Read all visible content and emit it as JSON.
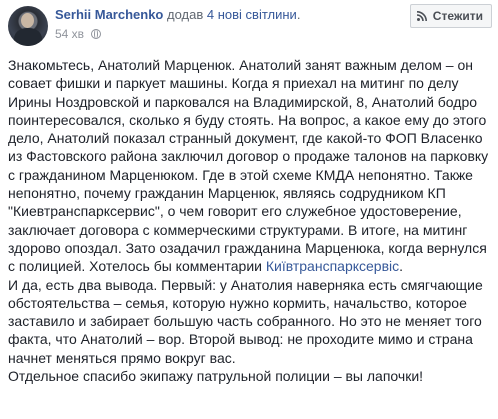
{
  "post": {
    "author": "Serhii Marchenko",
    "action_prefix": "додав",
    "action_link": "4 нові світлини",
    "action_suffix": ".",
    "time": "54 хв",
    "follow_label": "Стежити",
    "paragraphs": [
      {
        "text": "Знакомьтесь, Анатолий Марценюк. Анатолий занят важным делом – он совает фишки и паркует машины. Когда я приехал на митинг по делу Ирины Ноздровской и парковался на Владимирской, 8, Анатолий бодро поинтересовался, сколько я буду стоять. На вопрос, а какое ему до этого дело, Анатолий показал странный документ, где какой-то ФОП Власенко из Фастовского района заключил договор о продаже талонов на парковку с гражданином Марценюком. Где в этой схеме КМДА непонятно. Также непонятно, почему гражданин Марценюк, являясь содрудником КП \"Киевтранспарксервис\", о чем говорит его служебное удостоверение, заключает договора с коммерческими структурами. В итоге, на митинг здорово опоздал. Зато озадачил гражданина Марценюка, когда вернулся с полицией. Хотелось бы комментарии ",
        "link": "Київтранспарксервіс",
        "tail": "."
      },
      {
        "text": "И да, есть два вывода. Первый: у Анатолия наверняка есть смягчающие обстоятельства – семья, которую нужно кормить, начальство, которое заставило и забирает большую часть собранного. Но это не меняет того факта, что Анатолий – вор. Второй вывод: не проходите мимо и страна начнет меняться прямо вокруг вас."
      },
      {
        "text": "Отдельное спасибо экипажу патрульной полиции – вы лапочки!"
      }
    ]
  },
  "icons": {
    "avatar": "user-avatar",
    "privacy": "globe-icon",
    "follow": "rss-icon"
  },
  "colors": {
    "link": "#365899",
    "text": "#1d2129",
    "meta": "#90949c"
  }
}
